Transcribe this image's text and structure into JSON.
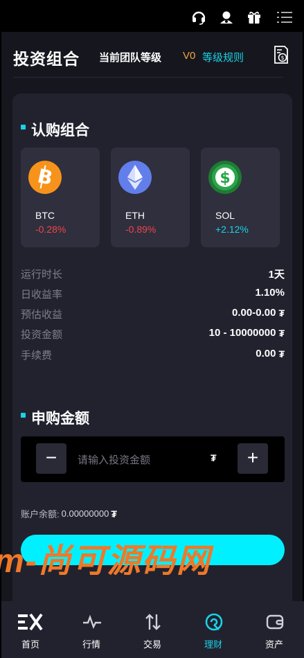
{
  "topbar": {
    "icons": [
      "headset-icon",
      "user-icon",
      "gift-icon",
      "menu-icon"
    ]
  },
  "header": {
    "title": "投资组合",
    "team_level_label": "当前团队等级",
    "level": "V0",
    "rules_label": "等级规则",
    "doc_icon": "document-coin-icon"
  },
  "subscribe": {
    "title": "认购组合",
    "coins": [
      {
        "symbol": "BTC",
        "change": "-0.28%",
        "trend": "down",
        "color": "#f7931a"
      },
      {
        "symbol": "ETH",
        "change": "-0.89%",
        "trend": "down",
        "color": "#627eea"
      },
      {
        "symbol": "SOL",
        "change": "+2.12%",
        "trend": "up",
        "color": "#2a9d3f"
      }
    ],
    "stats": [
      {
        "label": "运行时长",
        "value": "1天",
        "unit": ""
      },
      {
        "label": "日收益率",
        "value": "1.10%",
        "unit": ""
      },
      {
        "label": "预估收益",
        "value": "0.00-0.00",
        "unit": "₮"
      },
      {
        "label": "投资金额",
        "value": "10 - 10000000",
        "unit": "₮"
      },
      {
        "label": "手续费",
        "value": "0.00",
        "unit": "₮"
      }
    ]
  },
  "purchase": {
    "title": "申购金额",
    "minus": "−",
    "plus": "+",
    "placeholder": "请输入投资金额",
    "unit": "₮",
    "balance_label": "账户余额:",
    "balance_value": "0.00000000",
    "balance_unit": "₮"
  },
  "watermark": "m-尚可源码网",
  "nav": [
    {
      "label": "首页",
      "icon": "home-logo-icon",
      "active": false
    },
    {
      "label": "行情",
      "icon": "pulse-icon",
      "active": false
    },
    {
      "label": "交易",
      "icon": "swap-icon",
      "active": false
    },
    {
      "label": "理财",
      "icon": "finance-icon",
      "active": true
    },
    {
      "label": "资产",
      "icon": "wallet-icon",
      "active": false
    }
  ],
  "colors": {
    "accent": "#19d3e6",
    "button": "#00f0ff",
    "down": "#f0454a",
    "level": "#f0a840",
    "card": "#22222f"
  }
}
